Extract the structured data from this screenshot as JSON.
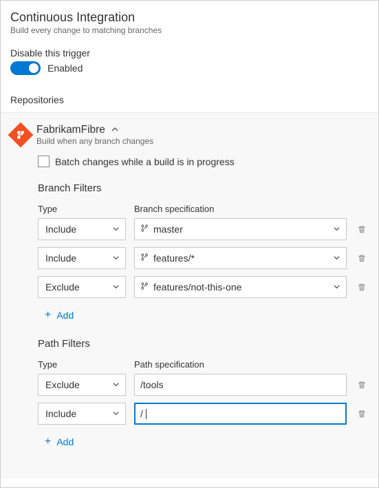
{
  "header": {
    "title": "Continuous Integration",
    "subtitle": "Build every change to matching branches"
  },
  "trigger": {
    "label": "Disable this trigger",
    "state_label": "Enabled"
  },
  "repositories": {
    "heading": "Repositories",
    "repo": {
      "name": "FabrikamFibre",
      "subtitle": "Build when any branch changes",
      "batch_label": "Batch changes while a build is in progress"
    }
  },
  "branch_filters": {
    "heading": "Branch Filters",
    "col_type": "Type",
    "col_spec": "Branch specification",
    "rows": [
      {
        "type": "Include",
        "spec": "master"
      },
      {
        "type": "Include",
        "spec": "features/*"
      },
      {
        "type": "Exclude",
        "spec": "features/not-this-one"
      }
    ],
    "add_label": "Add"
  },
  "path_filters": {
    "heading": "Path Filters",
    "col_type": "Type",
    "col_spec": "Path specification",
    "rows": [
      {
        "type": "Exclude",
        "spec": "/tools"
      },
      {
        "type": "Include",
        "spec": "/"
      }
    ],
    "add_label": "Add"
  }
}
